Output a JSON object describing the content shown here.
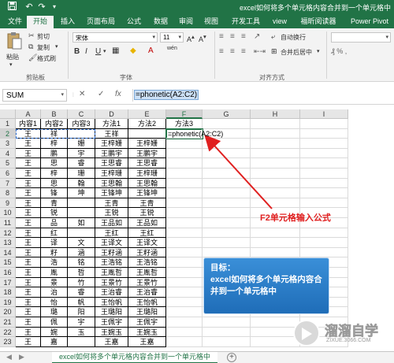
{
  "window": {
    "title": "excel如何将多个单元格内容合并到一个单元格中",
    "accent": "#217346"
  },
  "quick_access": [
    "save-icon",
    "undo-icon",
    "redo-icon"
  ],
  "tabs": [
    "文件",
    "开始",
    "插入",
    "页面布局",
    "公式",
    "数据",
    "审阅",
    "视图",
    "开发工具",
    "view",
    "福昕阅读器",
    "Power Pivot"
  ],
  "active_tab": "开始",
  "ribbon": {
    "clipboard": {
      "paste": "粘贴",
      "cut": "剪切",
      "copy": "复制",
      "format_painter": "格式刷",
      "group_label": "剪贴板"
    },
    "font": {
      "name": "宋体",
      "size": "11",
      "bold": "B",
      "italic": "I",
      "underline": "U",
      "wen": "wén",
      "group_label": "字体"
    },
    "alignment": {
      "wrap": "自动换行",
      "merge": "合并后居中",
      "group_label": "对齐方式"
    }
  },
  "formula_bar": {
    "name_box": "SUM",
    "cancel": "✕",
    "enter": "✓",
    "fx": "fx",
    "formula": "=phonetic(A2:C2)"
  },
  "grid": {
    "columns": [
      "A",
      "B",
      "C",
      "D",
      "E",
      "F",
      "G",
      "H",
      "I"
    ],
    "rows": [
      [
        "内容1",
        "内容2",
        "内容3",
        "方法1",
        "方法2",
        "方法3"
      ],
      [
        "王",
        "祥",
        "",
        "王祥",
        "",
        "=phonetic(A2:C2)"
      ],
      [
        "王",
        "梓",
        "姗",
        "王梓姗",
        "王梓姗",
        ""
      ],
      [
        "王",
        "鹏",
        "宇",
        "王鹏宇",
        "王鹏宇",
        ""
      ],
      [
        "王",
        "思",
        "睿",
        "王思睿",
        "王思睿",
        ""
      ],
      [
        "王",
        "梓",
        "珊",
        "王梓珊",
        "王梓珊",
        ""
      ],
      [
        "王",
        "思",
        "翰",
        "王思翰",
        "王思翰",
        ""
      ],
      [
        "王",
        "锋",
        "坤",
        "王锋坤",
        "王锋坤",
        ""
      ],
      [
        "王",
        "青",
        "",
        "王青",
        "王青",
        ""
      ],
      [
        "王",
        "锐",
        "",
        "王锐",
        "王锐",
        ""
      ],
      [
        "王",
        "品",
        "如",
        "王品如",
        "王品如",
        ""
      ],
      [
        "王",
        "红",
        "",
        "王红",
        "王红",
        ""
      ],
      [
        "王",
        "译",
        "文",
        "王译文",
        "王译文",
        ""
      ],
      [
        "王",
        "籽",
        "涵",
        "王籽涵",
        "王籽涵",
        ""
      ],
      [
        "王",
        "浩",
        "铭",
        "王浩铭",
        "王浩铭",
        ""
      ],
      [
        "王",
        "胤",
        "哲",
        "王胤哲",
        "王胤哲",
        ""
      ],
      [
        "王",
        "景",
        "竹",
        "王景竹",
        "王景竹",
        ""
      ],
      [
        "王",
        "治",
        "睿",
        "王治睿",
        "王治睿",
        ""
      ],
      [
        "王",
        "怡",
        "帆",
        "王怡帆",
        "王怡帆",
        ""
      ],
      [
        "王",
        "璐",
        "阳",
        "王璐阳",
        "王璐阳",
        ""
      ],
      [
        "王",
        "佩",
        "宇",
        "王佩宇",
        "王佩宇",
        ""
      ],
      [
        "王",
        "婉",
        "玉",
        "王婉玉",
        "王婉玉",
        ""
      ],
      [
        "王",
        "嘉",
        "",
        "王嘉",
        "王嘉",
        ""
      ]
    ]
  },
  "annotation": {
    "arrow_label": "F2单元格输入公式",
    "arrow_color": "#e02020",
    "goal_title": "目标：",
    "goal_text": "excel如何将多个单元格内容合并到一个单元格中"
  },
  "sheet_tab": "excel如何将多个单元格内容合并到一个单元格中",
  "add_sheet": "+",
  "watermark": {
    "brand": "溜溜自学",
    "url": "ZIXUE.3066.COM"
  }
}
